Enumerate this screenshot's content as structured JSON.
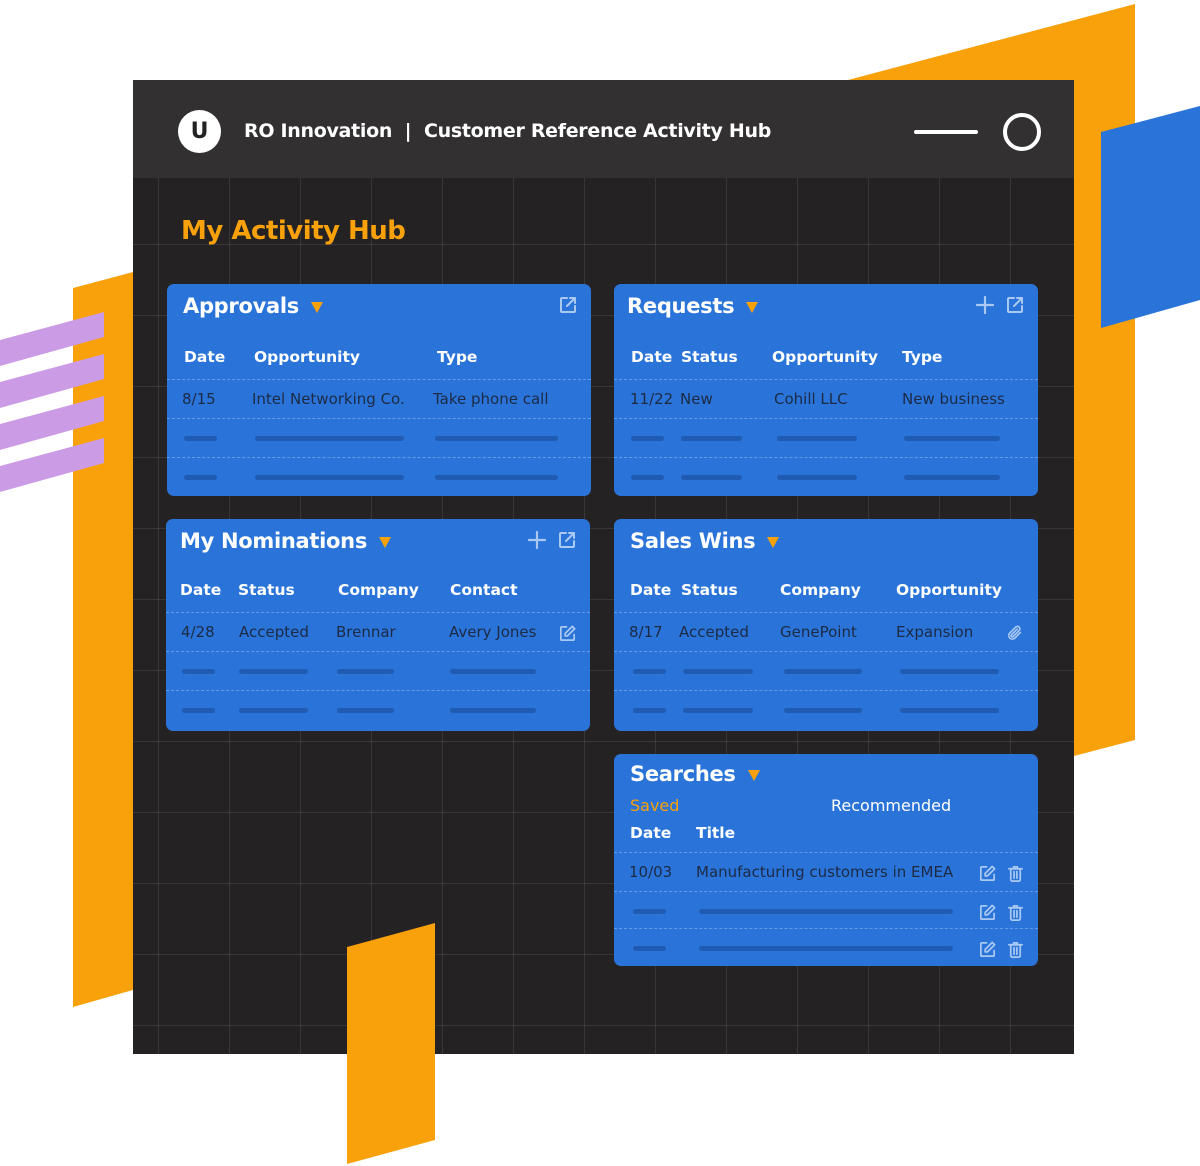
{
  "colors": {
    "accent_orange": "#f9a10a",
    "card_blue": "#2a74d9",
    "window_bg": "#252223",
    "titlebar_bg": "#333031",
    "deco_purple": "#cc9be6"
  },
  "window": {
    "logo_letter": "U",
    "title": "RO Innovation  |  Customer Reference Activity Hub",
    "minimize_icon": "minimize-icon",
    "maximize_icon": "circle-icon"
  },
  "hub": {
    "title": "My Activity Hub"
  },
  "cards": {
    "approvals": {
      "title": "Approvals",
      "actions": [
        "external-link-icon"
      ],
      "columns": [
        "Date",
        "Opportunity",
        "Type"
      ],
      "rows": [
        {
          "date": "8/15",
          "opportunity": "Intel Networking Co.",
          "type": "Take phone call"
        }
      ],
      "placeholder_rows": 2
    },
    "requests": {
      "title": "Requests",
      "actions": [
        "plus-icon",
        "external-link-icon"
      ],
      "columns": [
        "Date",
        "Status",
        "Opportunity",
        "Type"
      ],
      "rows": [
        {
          "date": "11/22",
          "status": "New",
          "opportunity": "Cohill LLC",
          "type": "New business"
        }
      ],
      "placeholder_rows": 2
    },
    "nominations": {
      "title": "My Nominations",
      "actions": [
        "plus-icon",
        "external-link-icon"
      ],
      "columns": [
        "Date",
        "Status",
        "Company",
        "Contact"
      ],
      "rows": [
        {
          "date": "4/28",
          "status": "Accepted",
          "company": "Brennar",
          "contact": "Avery Jones",
          "row_icon": "edit-icon"
        }
      ],
      "placeholder_rows": 2
    },
    "sales_wins": {
      "title": "Sales Wins",
      "actions": [],
      "columns": [
        "Date",
        "Status",
        "Company",
        "Opportunity"
      ],
      "rows": [
        {
          "date": "8/17",
          "status": "Accepted",
          "company": "GenePoint",
          "opportunity": "Expansion",
          "row_icon": "paperclip-icon"
        }
      ],
      "placeholder_rows": 2
    },
    "searches": {
      "title": "Searches",
      "tabs": [
        {
          "label": "Saved",
          "active": true
        },
        {
          "label": "Recommended",
          "active": false
        }
      ],
      "columns": [
        "Date",
        "Title"
      ],
      "rows": [
        {
          "date": "10/03",
          "title": "Manufacturing customers in EMEA",
          "row_icons": [
            "edit-icon",
            "trash-icon"
          ]
        }
      ],
      "placeholder_rows": 2
    }
  }
}
